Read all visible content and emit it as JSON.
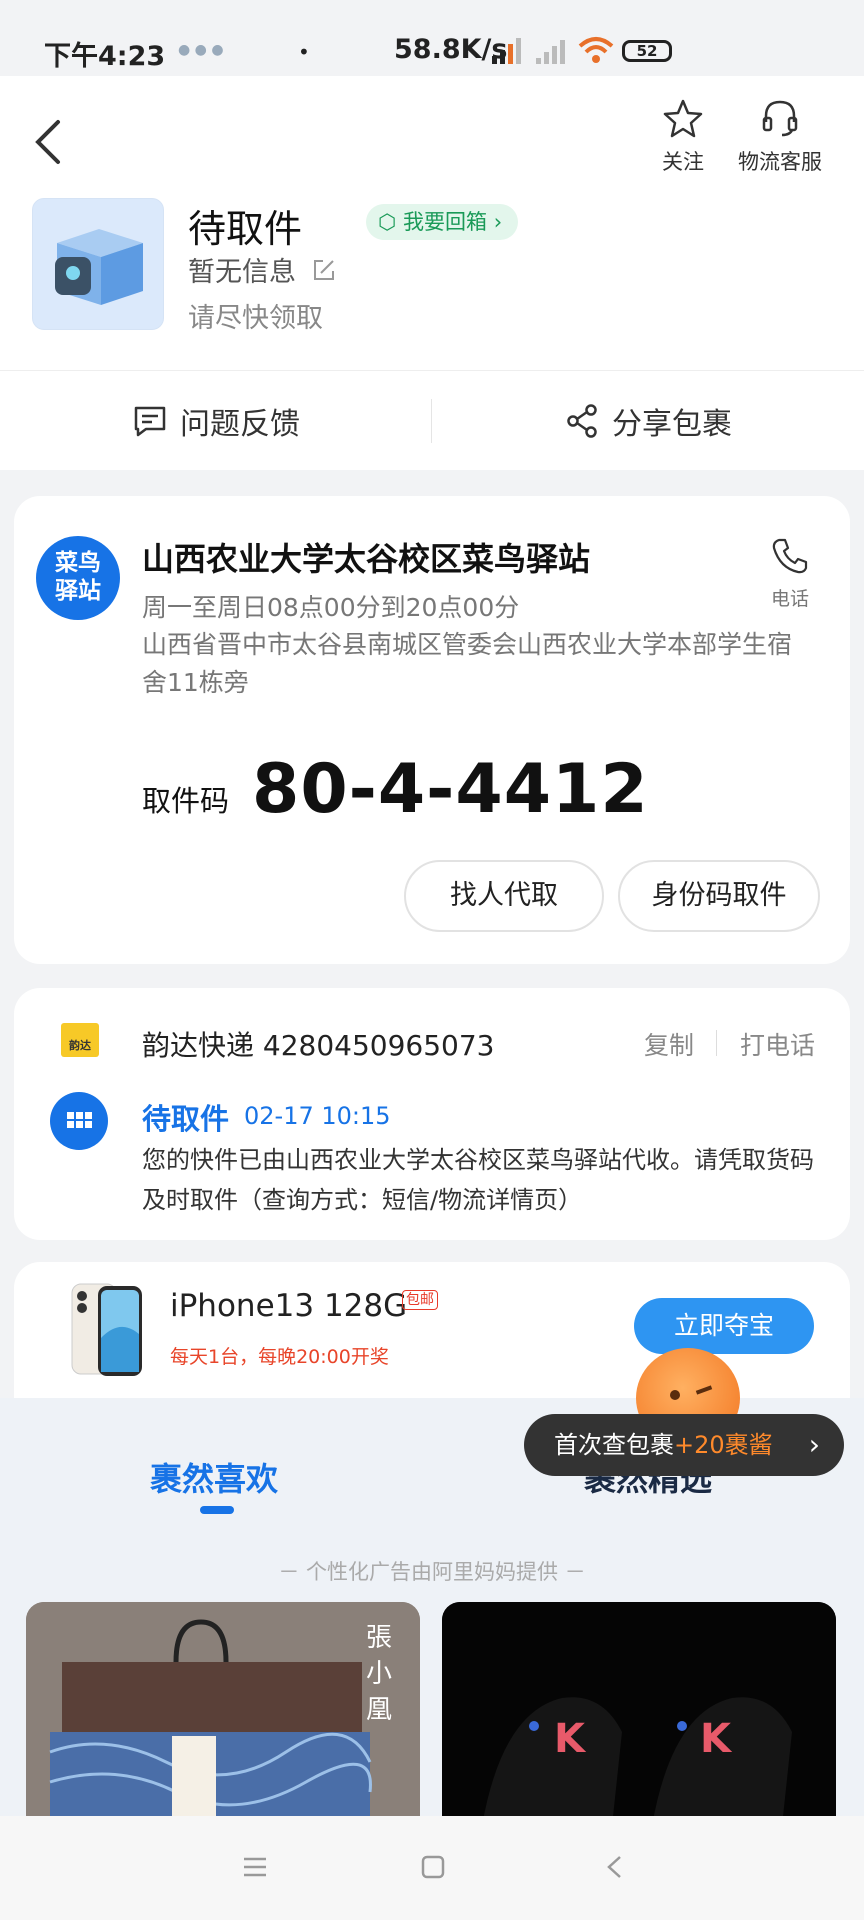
{
  "status_bar": {
    "time": "下午4:23",
    "speed": "58.8K/s",
    "battery": "52"
  },
  "header": {
    "follow_label": "关注",
    "service_label": "物流客服",
    "title": "待取件",
    "return_box_label": "我要回箱",
    "info": "暂无信息",
    "sub": "请尽快领取"
  },
  "actions": {
    "feedback": "问题反馈",
    "share": "分享包裹"
  },
  "station": {
    "logo_text": "菜鸟驿站",
    "name": "山西农业大学太谷校区菜鸟驿站",
    "hours": "周一至周日08点00分到20点00分",
    "address": "山西省晋中市太谷县南城区管委会山西农业大学本部学生宿舍11栋旁",
    "phone_label": "电话",
    "code_label": "取件码",
    "code": "80-4-4412",
    "btn_proxy": "找人代取",
    "btn_id": "身份码取件"
  },
  "tracking": {
    "courier_logo": "韵达",
    "courier": "韵达快递 4280450965073",
    "copy": "复制",
    "call": "打电话",
    "status": "待取件",
    "time": "02-17 10:15",
    "desc": "您的快件已由山西农业大学太谷校区菜鸟驿站代收。请凭取货码及时取件（查询方式：短信/物流详情页）"
  },
  "promo": {
    "product": "iPhone13 128G",
    "tag": "包邮",
    "sub": "每天1台，每晚20:00开奖",
    "button": "立即夺宝"
  },
  "tabs": {
    "tab1": "裹然喜欢",
    "tab2": "裹然精选",
    "ad_note": "－ 个性化广告由阿里妈妈提供 －"
  },
  "toast": {
    "prefix": "首次查包裹",
    "highlight": "+20裹酱"
  },
  "colors": {
    "primary": "#1773e6",
    "accent": "#ff8a2b",
    "green": "#1a9a58"
  }
}
